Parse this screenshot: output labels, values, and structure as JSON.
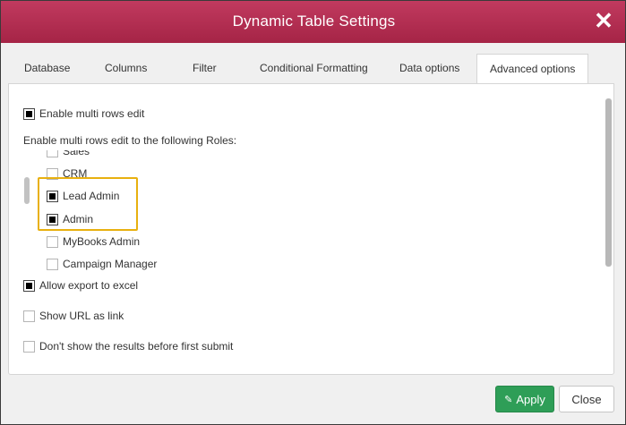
{
  "dialog": {
    "title": "Dynamic Table Settings",
    "close_glyph": "✕"
  },
  "tabs": [
    {
      "label": "Database",
      "active": false
    },
    {
      "label": "Columns",
      "active": false
    },
    {
      "label": "Filter",
      "active": false
    },
    {
      "label": "Conditional Formatting",
      "active": false
    },
    {
      "label": "Data options",
      "active": false
    },
    {
      "label": "Advanced options",
      "active": true
    }
  ],
  "options": {
    "enable_multi_rows_edit": {
      "label": "Enable multi rows edit",
      "checked": true
    },
    "roles_heading": "Enable multi rows edit to the following Roles:",
    "roles": [
      {
        "label": "Sales",
        "checked": false
      },
      {
        "label": "CRM",
        "checked": false
      },
      {
        "label": "Lead Admin",
        "checked": true
      },
      {
        "label": "Admin",
        "checked": true
      },
      {
        "label": "MyBooks Admin",
        "checked": false
      },
      {
        "label": "Campaign Manager",
        "checked": false
      }
    ],
    "allow_export_excel": {
      "label": "Allow export to excel",
      "checked": true
    },
    "show_url_as_link": {
      "label": "Show URL as link",
      "checked": false
    },
    "dont_show_results": {
      "label": "Don't show the results before first submit",
      "checked": false
    }
  },
  "footer": {
    "apply_label": "Apply",
    "close_label": "Close"
  },
  "colors": {
    "titlebar": "#b02d51",
    "apply": "#2e9e57",
    "highlight": "#e8b00f"
  }
}
